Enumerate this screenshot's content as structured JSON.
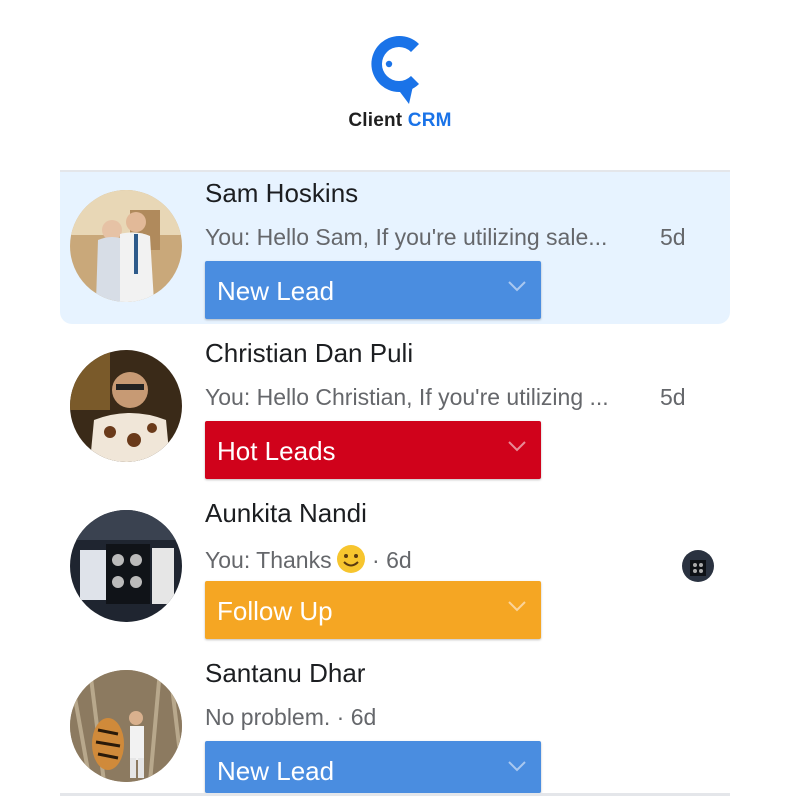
{
  "app": {
    "name_part1": "Client",
    "name_part2": "CRM",
    "brand_color": "#1a73e8"
  },
  "conversations": [
    {
      "name": "Sam Hoskins",
      "snippet": "You: Hello Sam, If you're utilizing sale...",
      "time": "5d",
      "status": "New Lead",
      "status_color": "#4a8de0",
      "active": true
    },
    {
      "name": "Christian Dan Puli",
      "snippet": "You: Hello Christian, If you're utilizing ...",
      "time": "5d",
      "status": "Hot Leads",
      "status_color": "#d0021b"
    },
    {
      "name": "Aunkita Nandi",
      "snippet": "You: Thanks",
      "emoji": "slightly-smiling-face-icon",
      "time": "6d",
      "status": "Follow Up",
      "status_color": "#f5a623",
      "seen_indicator": "seen-avatar"
    },
    {
      "name": "Santanu Dhar",
      "snippet": "No problem.",
      "time": "6d",
      "status": "New Lead",
      "status_color": "#4a8de0"
    }
  ]
}
